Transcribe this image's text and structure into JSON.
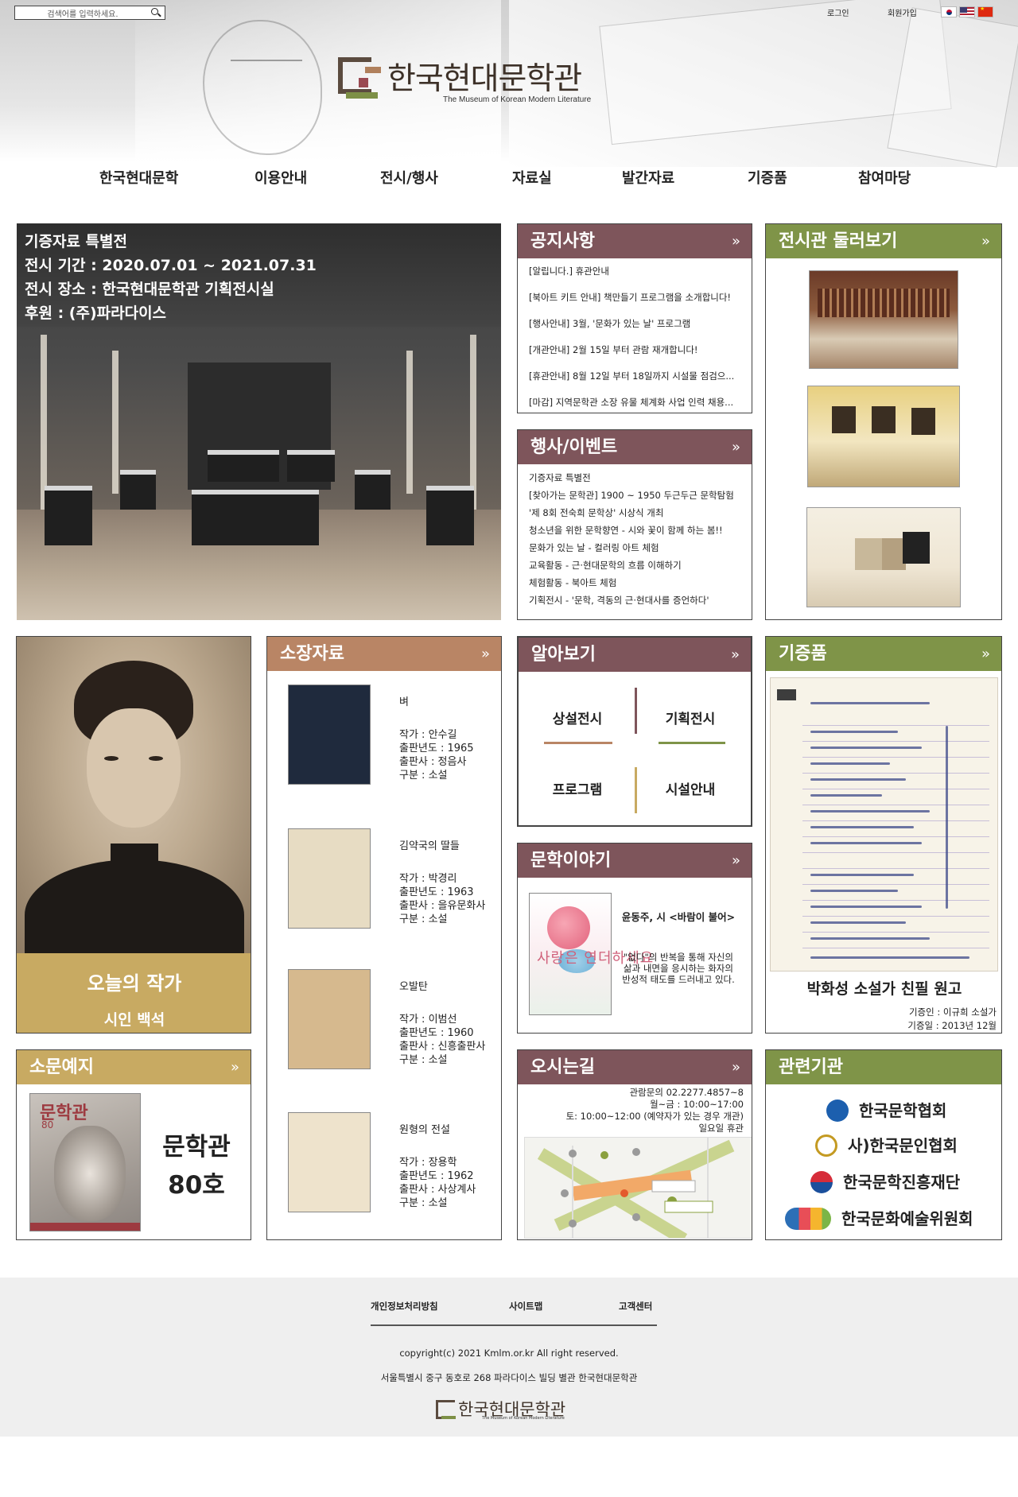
{
  "search": {
    "placeholder": "검색어를 입력하세요."
  },
  "top_links": {
    "login": "로그인",
    "join": "회원가입"
  },
  "site": {
    "title": "한국현대문학관",
    "subtitle": "The Museum of Korean Modern Literature"
  },
  "nav": [
    "한국현대문학",
    "이용안내",
    "전시/행사",
    "자료실",
    "발간자료",
    "기증품",
    "참여마당"
  ],
  "hero": {
    "line1": "기증자료 특별전",
    "line2": "전시 기간 : 2020.07.01 ~ 2021.07.31",
    "line3": "전시 장소 : 한국현대문학관 기획전시실",
    "line4": "후원 : (주)파라다이스"
  },
  "more_icon": "»",
  "notice": {
    "title": "공지사항",
    "items": [
      "[알립니다.] 휴관안내",
      "[북아트 키트 안내] 책만들기 프로그램을 소개합니다!",
      "[행사안내] 3월, '문화가 있는 날' 프로그램",
      "[개관안내] 2월 15일 부터 관람 재개합니다!",
      "[휴관안내] 8월 12일 부터 18일까지 시설물 점검으...",
      "[마감] 지역문학관 소장 유물 체계화 사업 인력 채용..."
    ]
  },
  "events": {
    "title": "행사/이벤트",
    "items": [
      "기증자료 특별전",
      "[찾아가는 문학관] 1900 ~ 1950 두근두근 문학탐험",
      "'제 8회 전숙희 문학상' 시상식 개최",
      "청소년을 위한 문학향연 - 시와 꽃이 함께 하는 봄!!",
      "문화가 있는 날 - 컬러링 아트 체험",
      "교육활동 - 근·현대문학의 흐름 이해하기",
      "체험활동 - 북아트 체험",
      "기획전시 - '문학, 격동의 근·현대사를 증언하다'"
    ]
  },
  "tour": {
    "title": "전시관 둘러보기"
  },
  "author": {
    "label": "오늘의 작가",
    "name": "시인 백석"
  },
  "collection": {
    "title": "소장자료",
    "items": [
      {
        "title": "벼",
        "author": "작가 : 안수길",
        "year": "출판년도 : 1965",
        "publisher": "출판사 : 정음사",
        "category": "구분 : 소설",
        "color": "#1f2a3d"
      },
      {
        "title": "김약국의 딸들",
        "author": "작가 : 박경리",
        "year": "출판년도 : 1963",
        "publisher": "출판사 : 을유문화사",
        "category": "구분 : 소설",
        "color": "#e7dcc3"
      },
      {
        "title": "오발탄",
        "author": "작가 : 이범선",
        "year": "출판년도 : 1960",
        "publisher": "출판사 : 신흥출판사",
        "category": "구분 : 소설",
        "color": "#d6b98e"
      },
      {
        "title": "원형의 전설",
        "author": "작가 : 장용학",
        "year": "출판년도 : 1962",
        "publisher": "출판사 : 사상계사",
        "category": "구분 : 소설",
        "color": "#eee3cc"
      }
    ]
  },
  "about": {
    "title": "알아보기",
    "items": [
      "상설전시",
      "기획전시",
      "프로그램",
      "시설안내"
    ]
  },
  "story": {
    "title": "문학이야기",
    "cover_title": "사랑은 연더하세요",
    "book_title": "윤동주, 시 <바람이 불어>",
    "desc": "\"없다\"의 반복을 통해 자신의 삶과 내면을 응시하는 화자의 반성적 태도를 드러내고 있다."
  },
  "donation": {
    "title": "기증품",
    "item_title": "박화성 소설가 친필 원고",
    "donor": "기증인 : 이규희 소설가",
    "date": "기증일 : 2013년 12월"
  },
  "newsletter": {
    "title": "소문예지",
    "cover_title": "문학관",
    "cover_number": "80",
    "name": "문학관",
    "issue": "80호"
  },
  "directions": {
    "title": "오시는길",
    "phone": "관람문의 02.2277.4857~8",
    "weekday": "월~금 : 10:00~17:00",
    "weekend": "토: 10:00~12:00 (예약자가 있는 경우 개관)",
    "closed": "일요일 휴관"
  },
  "related": {
    "title": "관련기관",
    "items": [
      "한국문학협회",
      "사)한국문인협회",
      "한국문학진흥재단",
      "한국문화예술위원회"
    ]
  },
  "footer": {
    "privacy": "개인정보처리방침",
    "sitemap": "사이트맵",
    "support": "고객센터",
    "copyright": "copyright(c) 2021 Kmlm.or.kr All right reserved.",
    "address": "서울특별시 중구 동호로 268 파라다이스 빌딩 별관 한국현대문학관",
    "logo_text": "한국현대문학관",
    "logo_sub": "The Museum of Korean Modern Literature"
  },
  "colors": {
    "maroon": "#7e555b",
    "olive": "#7f9448",
    "tan": "#b98565",
    "gold": "#c8aa62"
  }
}
